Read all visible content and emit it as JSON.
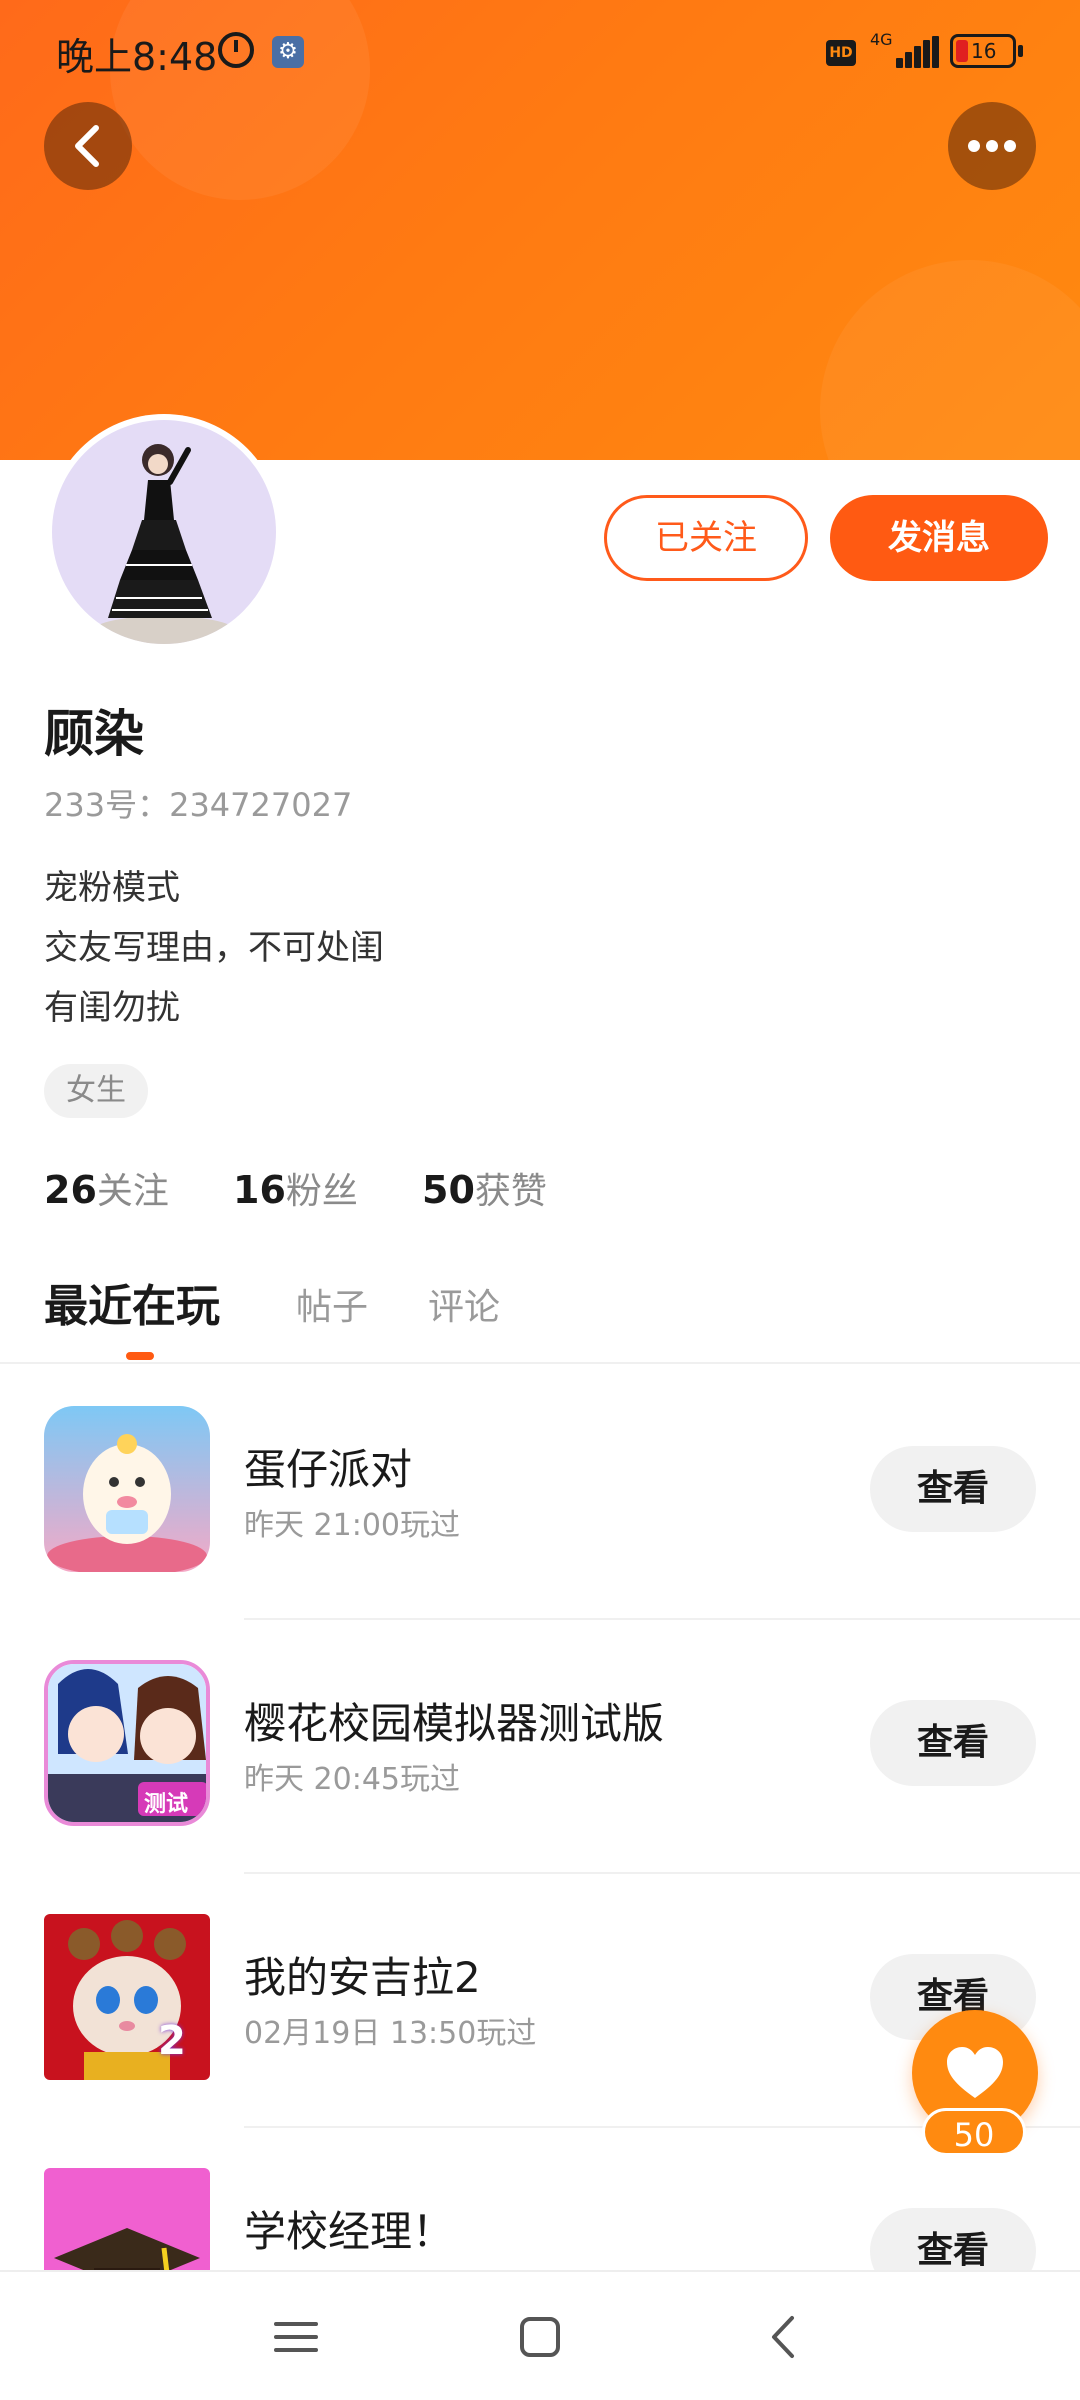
{
  "status_bar": {
    "time": "晚上8:48",
    "hd_label": "HD",
    "network": "4G",
    "battery": "16"
  },
  "colors": {
    "accent": "#ff5a12",
    "banner": "#ff7a12",
    "fab": "#ff8a10"
  },
  "profile": {
    "name": "顾染",
    "uid": "233号：234727027",
    "bio": [
      "宠粉模式",
      "交友写理由，不可处闺",
      "有闺勿扰"
    ],
    "gender_tag": "女生",
    "follow_button": "已关注",
    "message_button": "发消息"
  },
  "stats": [
    {
      "num": "26",
      "label": "关注"
    },
    {
      "num": "16",
      "label": "粉丝"
    },
    {
      "num": "50",
      "label": "获赞"
    }
  ],
  "tabs": [
    {
      "label": "最近在玩",
      "active": true
    },
    {
      "label": "帖子",
      "active": false
    },
    {
      "label": "评论",
      "active": false
    }
  ],
  "games": [
    {
      "title": "蛋仔派对",
      "played": "昨天 21:00玩过",
      "button": "查看"
    },
    {
      "title": "樱花校园模拟器测试版",
      "played": "昨天 20:45玩过",
      "button": "查看",
      "badge": "测试版"
    },
    {
      "title": "我的安吉拉2",
      "played": "02月19日 13:50玩过",
      "button": "查看",
      "badge": "2"
    },
    {
      "title": "学校经理！",
      "played": "",
      "button": "查看"
    }
  ],
  "fab": {
    "count": "50"
  },
  "icons": {
    "back": "back-arrow-icon",
    "more": "more-dots-icon",
    "like": "heart-icon",
    "nav_menu": "menu-icon",
    "nav_home": "home-square-icon",
    "nav_back": "nav-back-icon"
  }
}
